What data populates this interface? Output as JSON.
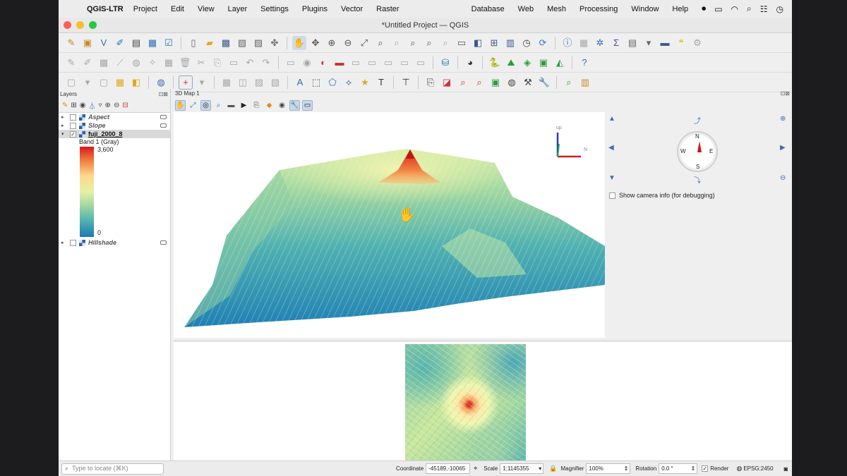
{
  "menubar": {
    "app_name": "QGIS-LTR",
    "items": [
      "Project",
      "Edit",
      "View",
      "Layer",
      "Settings",
      "Plugins",
      "Vector",
      "Raster",
      "Database",
      "Web",
      "Mesh",
      "Processing",
      "Window",
      "Help"
    ]
  },
  "window": {
    "title": "*Untitled Project — QGIS"
  },
  "colors": {
    "ramp_max": "#d7191c",
    "ramp_mid": "#e6f0a6",
    "ramp_min": "#1f78b4",
    "north_needle": "#dd1111"
  },
  "layers_panel": {
    "title": "Layers",
    "layers": [
      {
        "name": "Aspect",
        "checked": false,
        "active": false
      },
      {
        "name": "Slope",
        "checked": false,
        "active": false
      },
      {
        "name": "fuji_2000_8",
        "checked": true,
        "active": true
      },
      {
        "name": "Hillshade",
        "checked": false,
        "active": false
      }
    ],
    "band_label": "Band 1 (Gray)",
    "legend_max": "3,600",
    "legend_min": "0"
  },
  "map3d": {
    "title": "3D Map 1",
    "axis_labels": {
      "up": "up",
      "north": "N"
    },
    "compass": {
      "n": "N",
      "s": "S",
      "e": "E",
      "w": "W"
    },
    "camera_info_label": "Show camera info (for debugging)",
    "camera_info_checked": false
  },
  "statusbar": {
    "locate_placeholder": "Type to locate (⌘K)",
    "coordinate_label": "Coordinate",
    "coordinate_value": "-45189,-10065",
    "scale_label": "Scale",
    "scale_value": "1:1145355",
    "magnifier_label": "Magnifier",
    "magnifier_value": "100%",
    "rotation_label": "Rotation",
    "rotation_value": "0.0 °",
    "render_label": "Render",
    "render_checked": true,
    "crs": "EPSG:2450"
  }
}
